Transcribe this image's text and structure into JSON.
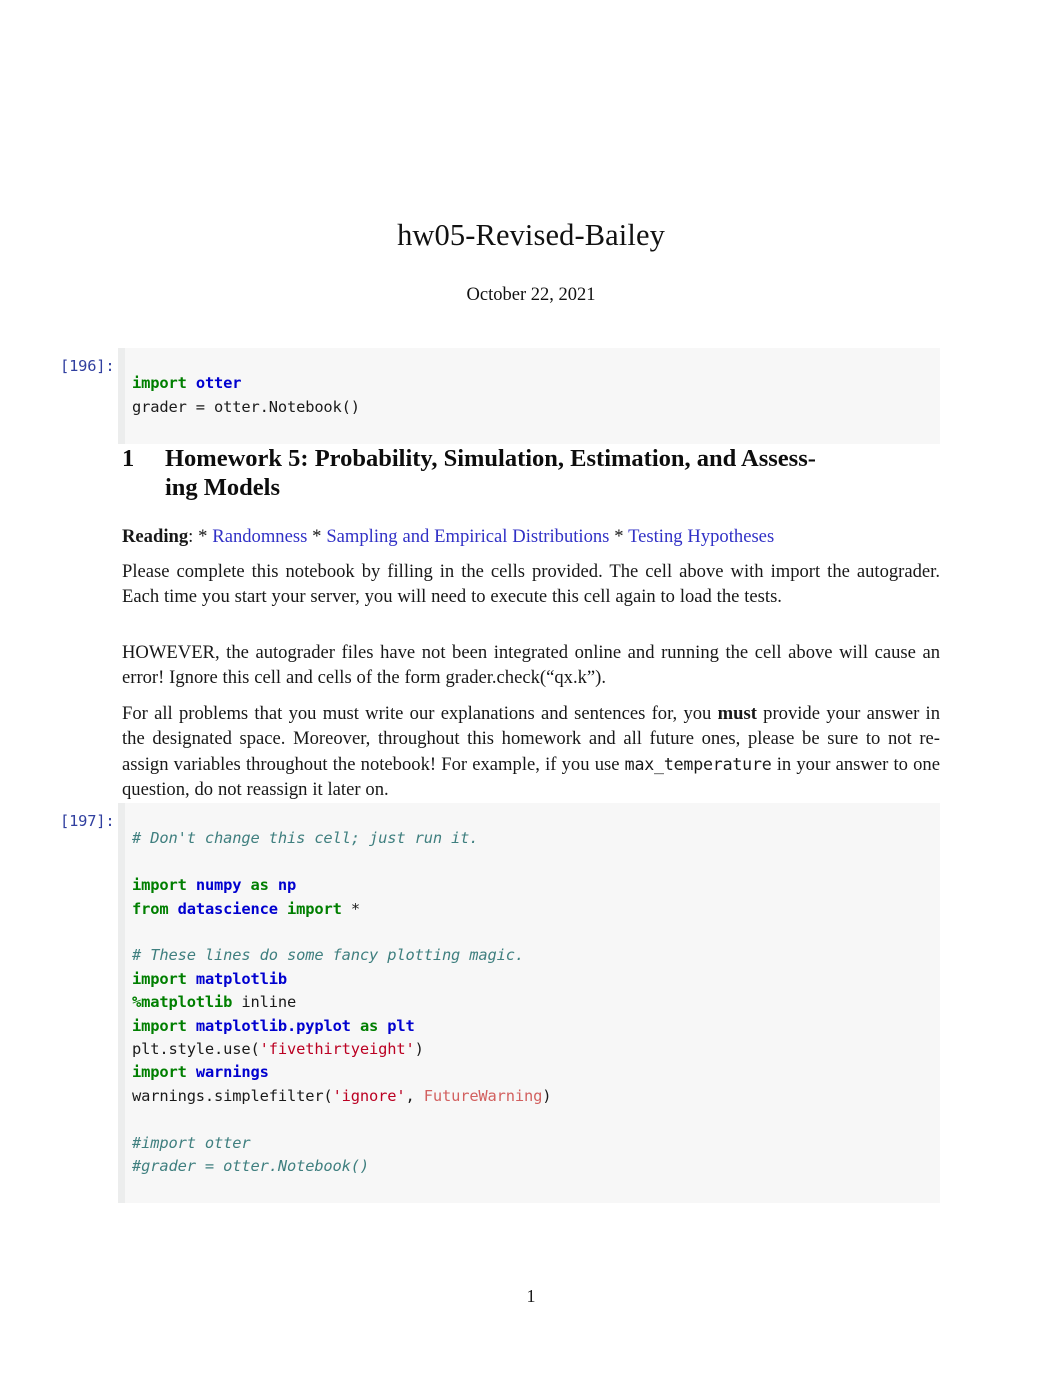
{
  "document": {
    "title": "hw05-Revised-Bailey",
    "date": "October 22, 2021",
    "page_number": "1"
  },
  "cells": {
    "cell1": {
      "prompt": "[196]:",
      "lines": [
        [
          {
            "t": "import",
            "c": "kw"
          },
          {
            "t": " ",
            "c": "plain"
          },
          {
            "t": "otter",
            "c": "mod"
          }
        ],
        [
          {
            "t": "grader = otter.Notebook()",
            "c": "plain"
          }
        ]
      ]
    },
    "cell2": {
      "prompt": "[197]:",
      "lines": [
        [
          {
            "t": "# Don't change this cell; just run it.",
            "c": "cmt"
          }
        ],
        [
          {
            "t": "",
            "c": "plain"
          }
        ],
        [
          {
            "t": "import",
            "c": "kw"
          },
          {
            "t": " ",
            "c": "plain"
          },
          {
            "t": "numpy",
            "c": "mod"
          },
          {
            "t": " ",
            "c": "plain"
          },
          {
            "t": "as",
            "c": "kw"
          },
          {
            "t": " ",
            "c": "plain"
          },
          {
            "t": "np",
            "c": "mod"
          }
        ],
        [
          {
            "t": "from",
            "c": "kw"
          },
          {
            "t": " ",
            "c": "plain"
          },
          {
            "t": "datascience",
            "c": "mod"
          },
          {
            "t": " ",
            "c": "plain"
          },
          {
            "t": "import",
            "c": "kw"
          },
          {
            "t": " *",
            "c": "plain"
          }
        ],
        [
          {
            "t": "",
            "c": "plain"
          }
        ],
        [
          {
            "t": "# These lines do some fancy plotting magic.",
            "c": "cmt"
          }
        ],
        [
          {
            "t": "import",
            "c": "kw"
          },
          {
            "t": " ",
            "c": "plain"
          },
          {
            "t": "matplotlib",
            "c": "mod"
          }
        ],
        [
          {
            "t": "%matplotlib",
            "c": "kw"
          },
          {
            "t": " inline",
            "c": "plain"
          }
        ],
        [
          {
            "t": "import",
            "c": "kw"
          },
          {
            "t": " ",
            "c": "plain"
          },
          {
            "t": "matplotlib.pyplot",
            "c": "mod"
          },
          {
            "t": " ",
            "c": "plain"
          },
          {
            "t": "as",
            "c": "kw"
          },
          {
            "t": " ",
            "c": "plain"
          },
          {
            "t": "plt",
            "c": "mod"
          }
        ],
        [
          {
            "t": "plt.style.use(",
            "c": "plain"
          },
          {
            "t": "'fivethirtyeight'",
            "c": "str"
          },
          {
            "t": ")",
            "c": "plain"
          }
        ],
        [
          {
            "t": "import",
            "c": "kw"
          },
          {
            "t": " ",
            "c": "plain"
          },
          {
            "t": "warnings",
            "c": "mod"
          }
        ],
        [
          {
            "t": "warnings.simplefilter(",
            "c": "plain"
          },
          {
            "t": "'ignore'",
            "c": "str"
          },
          {
            "t": ", ",
            "c": "plain"
          },
          {
            "t": "FutureWarning",
            "c": "exc"
          },
          {
            "t": ")",
            "c": "plain"
          }
        ],
        [
          {
            "t": "",
            "c": "plain"
          }
        ],
        [
          {
            "t": "#import otter",
            "c": "cmt"
          }
        ],
        [
          {
            "t": "#grader = otter.Notebook()",
            "c": "cmt"
          }
        ]
      ]
    }
  },
  "section": {
    "number": "1",
    "title_line1": "Homework 5: Probability, Simulation, Estimation, and Assess-",
    "title_line2": "ing Models"
  },
  "reading": {
    "label": "Reading",
    "colon": ": * ",
    "link1": "Randomness",
    "sep1": " * ",
    "link2": "Sampling and Empirical Distributions",
    "sep2": " * ",
    "link3": "Testing Hypotheses"
  },
  "paragraphs": {
    "p1": "Please complete this notebook by filling in the cells provided. The cell above with import the autograder. Each time you start your server, you will need to execute this cell again to load the tests.",
    "p2": "HOWEVER, the autograder files have not been integrated online and running the cell above will cause an error! Ignore this cell and cells of the form grader.check(“qx.k”).",
    "p3_a": "For all problems that you must write our explanations and sentences for, you ",
    "p3_bold": "must",
    "p3_b": " provide your answer in the designated space. Moreover, throughout this homework and all future ones, please be sure to not re-assign variables throughout the notebook! For example, if you use ",
    "p3_mono": "max_temperature",
    "p3_c": " in your answer to one question, do not reassign it later on."
  },
  "colors": {
    "link": "#3131c6",
    "prompt": "#303f9f",
    "code_bg": "#f7f7f7",
    "gutter": "#eceded",
    "keyword": "#007f00",
    "module": "#0000cf",
    "comment": "#3f7f7f",
    "string": "#bb0022",
    "exception": "#d2605f"
  }
}
